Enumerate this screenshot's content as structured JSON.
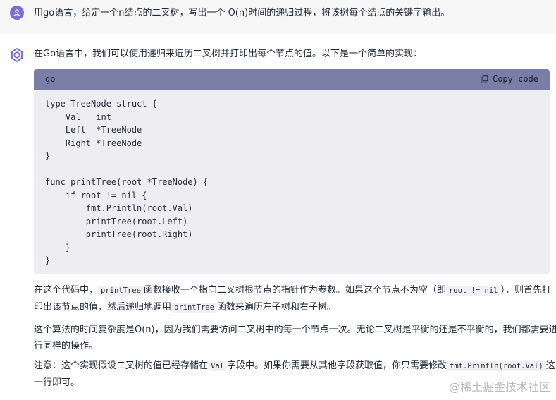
{
  "user": {
    "icon": "user-icon",
    "question": "用go语言，给定一个n结点的二叉树，写出一个 O(n)时间的递归过程，将该树每个结点的关键字输出。"
  },
  "assistant": {
    "icon": "assistant-logo-icon",
    "intro": "在Go语言中，我们可以使用递归来遍历二叉树并打印出每个节点的值。以下是一个简单的实现："
  },
  "code_block": {
    "language": "go",
    "copy_label": "Copy code",
    "copy_icon": "clipboard-icon",
    "lines": [
      "type TreeNode struct {",
      "    Val   int",
      "    Left  *TreeNode",
      "    Right *TreeNode",
      "}",
      "",
      "func printTree(root *TreeNode) {",
      "    if root != nil {",
      "        fmt.Println(root.Val)",
      "        printTree(root.Left)",
      "        printTree(root.Right)",
      "    }",
      "}"
    ]
  },
  "paragraphs": {
    "p1": {
      "t1": "在这个代码中，",
      "c1": "printTree",
      "t2": "函数接收一个指向二叉树根节点的指针作为参数。如果这个节点不为空（即",
      "c2": "root != nil",
      "t3": "），则首先打",
      "t4": "印出该节点的值，然后递归地调用",
      "c3": "printTree",
      "t5": "函数来遍历左子树和右子树。"
    },
    "p2": {
      "line1": "这个算法的时间复杂度是O(n)，因为我们需要访问二叉树中的每一个节点一次。无论二叉树是平衡的还是不平衡的，我们都需要进",
      "line2": "行同样的操作。"
    },
    "p3": {
      "t1": "注意：这个实现假设二叉树的值已经存储在",
      "c1": "Val",
      "t2": "字段中。如果你需要从其他字段获取值，你只需要修改",
      "c2": "fmt.Println(root.Val)",
      "t3": "这",
      "t4": "一行即可。"
    }
  },
  "watermark": {
    "text": "@稀土掘金技术社区"
  }
}
